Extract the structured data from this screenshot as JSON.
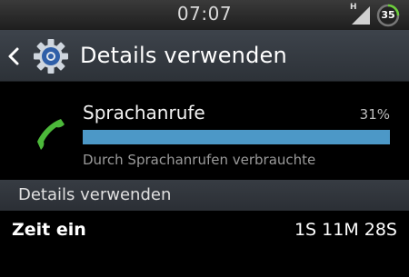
{
  "status_bar": {
    "time": "07:07",
    "network_type": "H",
    "battery_level": "35"
  },
  "action_bar": {
    "title": "Details verwenden",
    "back_icon": "chevron-left-icon",
    "app_icon": "gear-icon"
  },
  "usage": {
    "name": "Sprachanrufe",
    "percent_label": "31%",
    "percent_value": 31,
    "description": "Durch Sprachanrufen verbrauchte",
    "icon": "phone-call-icon",
    "bar_color": "#4c98c7"
  },
  "section": {
    "title": "Details verwenden"
  },
  "details": [
    {
      "label": "Zeit ein",
      "value": "1S 11M 28S"
    }
  ]
}
